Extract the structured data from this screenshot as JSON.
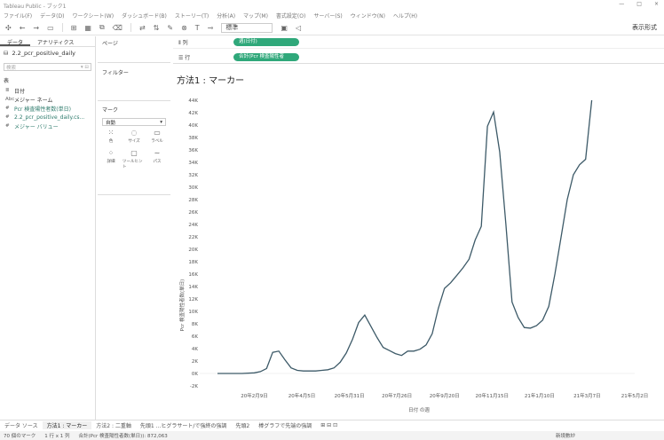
{
  "window": {
    "title": "Tableau Public - ブック1",
    "controls": [
      "—",
      "□",
      "×"
    ]
  },
  "menu": [
    "ファイル(F)",
    "データ(D)",
    "ワークシート(W)",
    "ダッシュボード(B)",
    "ストーリー(T)",
    "分析(A)",
    "マップ(M)",
    "書式設定(O)",
    "サーバー(S)",
    "ウィンドウ(N)",
    "ヘルプ(H)"
  ],
  "toolbar": {
    "fit": "標準",
    "show_label": "表示形式"
  },
  "data_pane": {
    "tab_data": "データ",
    "tab_analytics": "アナリティクス",
    "source": "2.2_pcr_positive_daily",
    "search_placeholder": "検索",
    "table_header": "表",
    "fields": [
      {
        "icon": "≣",
        "label": "日付",
        "measure": false
      },
      {
        "icon": "Abc",
        "label": "メジャー ネーム",
        "measure": false
      },
      {
        "icon": "#",
        "label": "Pcr 検査陽性者数(単日)",
        "measure": true
      },
      {
        "icon": "#",
        "label": "2.2_pcr_positive_daily.cs...",
        "measure": true
      },
      {
        "icon": "#",
        "label": "メジャー バリュー",
        "measure": true
      }
    ]
  },
  "cards": {
    "pages": "ページ",
    "filters": "フィルター",
    "marks": "マーク",
    "mark_type": "自動",
    "buttons": [
      "色",
      "サイズ",
      "ラベル",
      "詳細",
      "ツールヒント",
      "パス"
    ]
  },
  "shelves": {
    "columns_label": "列",
    "columns_pill": "週(日付)",
    "rows_label": "行",
    "rows_pill": "合計(Pcr 検査陽性者"
  },
  "view": {
    "title": "方法1 : マーカー"
  },
  "chart_data": {
    "type": "line",
    "title": "方法1 : マーカー",
    "xlabel": "日付 の週",
    "ylabel": "Pcr 検査陽性者数(単日)",
    "ylim": [
      -2000,
      44000
    ],
    "y_ticks": [
      "-2K",
      "0K",
      "2K",
      "4K",
      "6K",
      "8K",
      "10K",
      "12K",
      "14K",
      "16K",
      "18K",
      "20K",
      "22K",
      "24K",
      "26K",
      "28K",
      "30K",
      "32K",
      "34K",
      "36K",
      "38K",
      "40K",
      "42K",
      "44K"
    ],
    "x_ticks": [
      "20年2月9日",
      "20年4月5日",
      "20年5月31日",
      "20年7月26日",
      "20年9月20日",
      "20年11月15日",
      "21年1月10日",
      "21年3月7日",
      "21年5月2日"
    ],
    "color": "#3d5a68",
    "x": [
      0,
      4,
      8,
      12,
      14,
      16,
      18,
      20,
      22,
      24,
      26,
      28,
      30,
      32,
      34,
      36,
      38,
      40,
      42,
      44,
      46,
      48,
      50,
      52,
      54,
      56,
      58,
      60,
      62,
      64,
      66,
      68,
      70,
      72,
      74,
      76,
      78,
      80,
      82,
      84,
      86,
      88,
      90,
      92,
      94,
      96,
      98,
      100,
      102,
      104,
      106,
      108,
      110,
      112,
      114,
      116,
      118,
      120,
      122,
      124,
      126,
      128,
      130,
      132,
      134,
      136
    ],
    "y": [
      0,
      0,
      0,
      100,
      300,
      800,
      3400,
      3600,
      2200,
      900,
      500,
      400,
      400,
      400,
      500,
      600,
      900,
      1800,
      3300,
      5500,
      8200,
      9400,
      7600,
      5800,
      4200,
      3700,
      3200,
      2900,
      3600,
      3600,
      3900,
      4600,
      6400,
      10500,
      13700,
      14600,
      15800,
      17000,
      18400,
      21500,
      23700,
      39800,
      42100,
      35700,
      24000,
      11500,
      9000,
      7400,
      7300,
      7700,
      8600,
      10800,
      16000,
      22000,
      28000,
      32000,
      33600,
      34500,
      44000
    ]
  },
  "sheet_tabs": [
    "データ ソース",
    "方法1 : マーカー",
    "方法2 : 二重軸",
    "先頭1 ...ヒグラサート/で強終の強調",
    "先頭2",
    "棒グラフで先端の強調"
  ],
  "status": {
    "marks": "70 個のマーク",
    "rows": "1 行 x 1 列",
    "sum": "合計(Pcr 検査陽性者数(単日)): 872,063",
    "user": "新境數紗"
  }
}
